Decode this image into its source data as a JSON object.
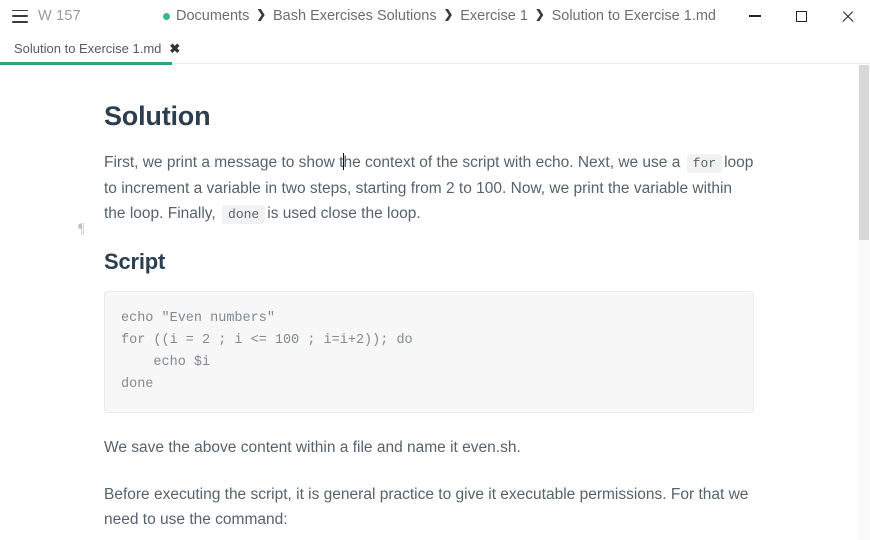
{
  "titlebar": {
    "menu_icon": "hamburger-icon",
    "window_label": "W 157",
    "breadcrumb": {
      "status_dot_color": "#3eb489",
      "separator": "❯",
      "items": [
        {
          "label": "Documents"
        },
        {
          "label": "Bash Exercises Solutions"
        },
        {
          "label": "Exercise 1"
        },
        {
          "label": "Solution to Exercise 1.md"
        }
      ]
    },
    "controls": {
      "minimize": "minimize-icon",
      "maximize": "maximize-icon",
      "close": "close-icon"
    }
  },
  "tabbar": {
    "active_accent": "#2aa870",
    "tabs": [
      {
        "title": "Solution to Exercise 1.md",
        "close_glyph": "✖"
      }
    ]
  },
  "document": {
    "gutter_marker": "¶",
    "heading": "Solution",
    "paragraph1": {
      "part_a": "First, we print a message to show t",
      "part_b": "he context of the script with echo. Next, we use a",
      "code1": "for",
      "part_c": "loop to increment a variable in two steps, starting from 2 to 100. Now, we print the variable within the loop. Finally,",
      "code2": "done",
      "part_d": "is used close the loop."
    },
    "subheading": "Script",
    "code_block": "echo \"Even numbers\"\nfor ((i = 2 ; i <= 100 ; i=i+2)); do\n    echo $i\ndone",
    "paragraph2": "We save the above content within a file and name it even.sh.",
    "paragraph3": "Before executing the script, it is general practice to give it executable permissions. For that we need to use the command:"
  },
  "scrollbar": {
    "track_color": "#fafafa",
    "thumb_color": "#d8d8d8"
  }
}
